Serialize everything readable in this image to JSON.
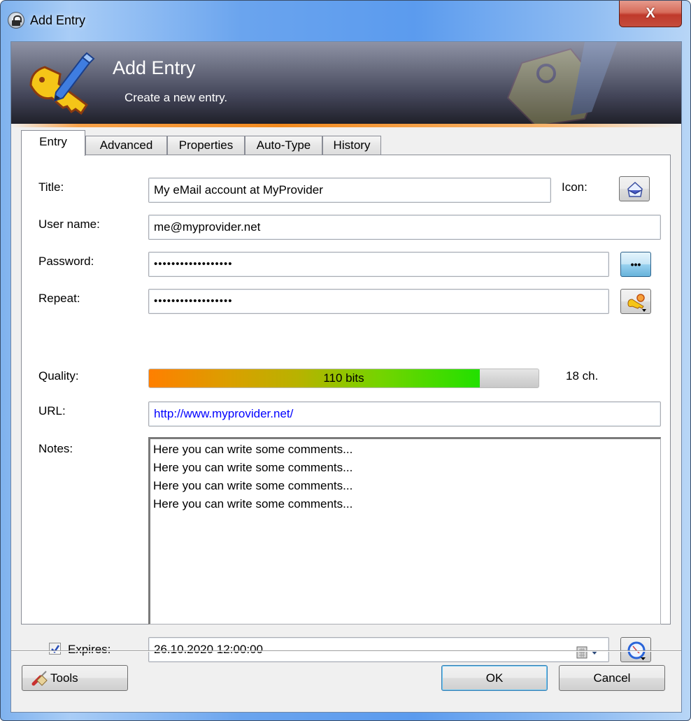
{
  "window": {
    "title": "Add Entry",
    "title_icon": "lock-icon",
    "close_label": "X"
  },
  "banner": {
    "title": "Add Entry",
    "subtitle": "Create a new entry.",
    "icon": "key-pencil-icon"
  },
  "tabs": [
    {
      "label": "Entry",
      "active": true
    },
    {
      "label": "Advanced",
      "active": false
    },
    {
      "label": "Properties",
      "active": false
    },
    {
      "label": "Auto-Type",
      "active": false
    },
    {
      "label": "History",
      "active": false
    }
  ],
  "form": {
    "title": {
      "label": "Title:",
      "value": "My eMail account at MyProvider"
    },
    "icon": {
      "label": "Icon:",
      "icon": "envelope-icon"
    },
    "username": {
      "label": "User name:",
      "value": "me@myprovider.net"
    },
    "password": {
      "label": "Password:",
      "value": "••••••••••••••••••",
      "toggle_icon": "hide-password-icon",
      "toggle_label": "•••"
    },
    "repeat": {
      "label": "Repeat:",
      "value": "••••••••••••••••••",
      "generator_icon": "password-generator-icon"
    },
    "quality": {
      "label": "Quality:",
      "bar_text": "110 bits",
      "fill_fraction": 0.85,
      "length_text": "18 ch."
    },
    "url": {
      "label": "URL:",
      "value": "http://www.myprovider.net/"
    },
    "notes": {
      "label": "Notes:",
      "value": "Here you can write some comments...\nHere you can write some comments...\nHere you can write some comments...\nHere you can write some comments..."
    },
    "expires": {
      "label": "Expires:",
      "checked": true,
      "value": "26.10.2020 12:00:00",
      "calendar_icon": "calendar-dropdown-icon",
      "preset_icon": "clock-icon"
    }
  },
  "buttons": {
    "tools": "Tools",
    "ok": "OK",
    "cancel": "Cancel"
  },
  "colors": {
    "url_text": "#0000ff",
    "banner_accent": "#f28a1e",
    "quality_low": "#ff7f00",
    "quality_high": "#22e000"
  }
}
